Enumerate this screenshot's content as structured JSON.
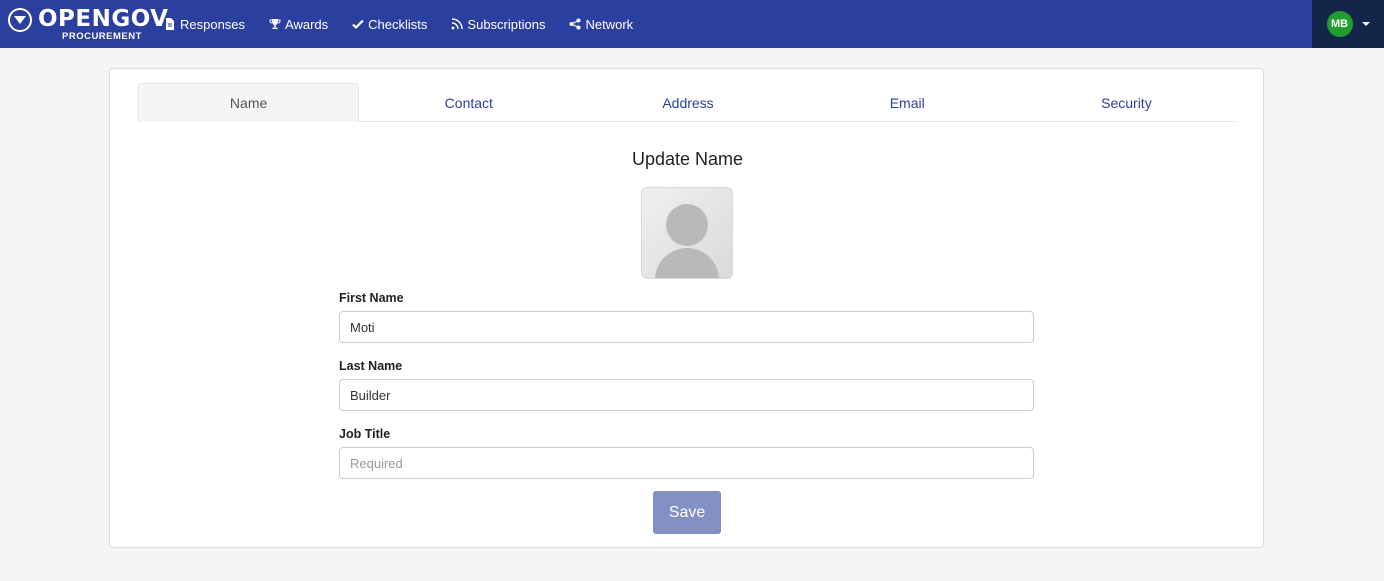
{
  "brand": {
    "name": "OPENGOV",
    "product": "PROCUREMENT"
  },
  "nav": {
    "items": [
      {
        "label": "Responses",
        "icon": "file-icon"
      },
      {
        "label": "Awards",
        "icon": "trophy-icon"
      },
      {
        "label": "Checklists",
        "icon": "check-icon"
      },
      {
        "label": "Subscriptions",
        "icon": "rss-icon"
      },
      {
        "label": "Network",
        "icon": "share-icon"
      }
    ]
  },
  "user": {
    "initials": "MB"
  },
  "tabs": [
    {
      "label": "Name",
      "active": true
    },
    {
      "label": "Contact",
      "active": false
    },
    {
      "label": "Address",
      "active": false
    },
    {
      "label": "Email",
      "active": false
    },
    {
      "label": "Security",
      "active": false
    }
  ],
  "form": {
    "title": "Update Name",
    "first_name": {
      "label": "First Name",
      "value": "Moti"
    },
    "last_name": {
      "label": "Last Name",
      "value": "Builder"
    },
    "job_title": {
      "label": "Job Title",
      "value": "",
      "placeholder": "Required"
    },
    "save_label": "Save"
  },
  "colors": {
    "navbar": "#2a3f9e",
    "user_area": "#14254a",
    "avatar": "#1f9e2e",
    "link": "#2a3f9e",
    "save_button": "#8390c4"
  }
}
